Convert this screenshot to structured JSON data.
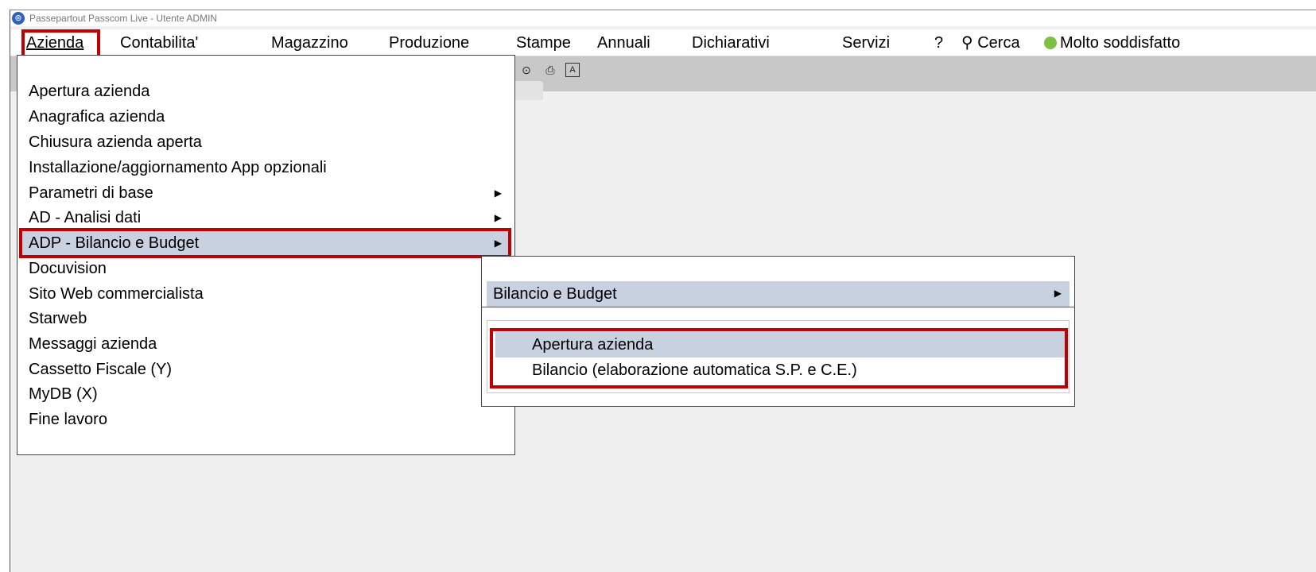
{
  "window": {
    "title": "Passepartout Passcom Live - Utente ADMIN"
  },
  "menubar": {
    "items": [
      {
        "label": "Azienda"
      },
      {
        "label": "Contabilita'"
      },
      {
        "label": "Magazzino"
      },
      {
        "label": "Produzione"
      },
      {
        "label": "Stampe"
      },
      {
        "label": "Annuali"
      },
      {
        "label": "Dichiarativi"
      },
      {
        "label": "Servizi"
      },
      {
        "label": "?"
      }
    ],
    "search_label": "Cerca",
    "feedback_label": "Molto soddisfatto"
  },
  "azienda_menu": {
    "items": [
      {
        "label": "Apertura azienda"
      },
      {
        "label": "Anagrafica azienda"
      },
      {
        "label": "Chiusura azienda aperta"
      },
      {
        "label": "Installazione/aggiornamento App opzionali"
      },
      {
        "label": "Parametri di base"
      },
      {
        "label": "AD - Analisi dati"
      },
      {
        "label": "ADP - Bilancio e Budget"
      },
      {
        "label": "Docuvision"
      },
      {
        "label": "Sito Web commercialista"
      },
      {
        "label": "Starweb"
      },
      {
        "label": "Messaggi azienda"
      },
      {
        "label": "Cassetto Fiscale (Y)"
      },
      {
        "label": "MyDB (X)"
      },
      {
        "label": "Fine lavoro"
      }
    ]
  },
  "adp_submenu": {
    "header": "Bilancio e Budget",
    "items": [
      {
        "label": "Apertura azienda"
      },
      {
        "label": "Bilancio (elaborazione automatica S.P. e C.E.)"
      }
    ]
  },
  "colors": {
    "highlight": "#c7d1df",
    "annotation_red": "#c00000"
  },
  "icons": [
    "app-icon",
    "radio-icon",
    "monitor-icon",
    "font-icon",
    "search-icon",
    "smiley-icon",
    "chevron-right-icon"
  ]
}
